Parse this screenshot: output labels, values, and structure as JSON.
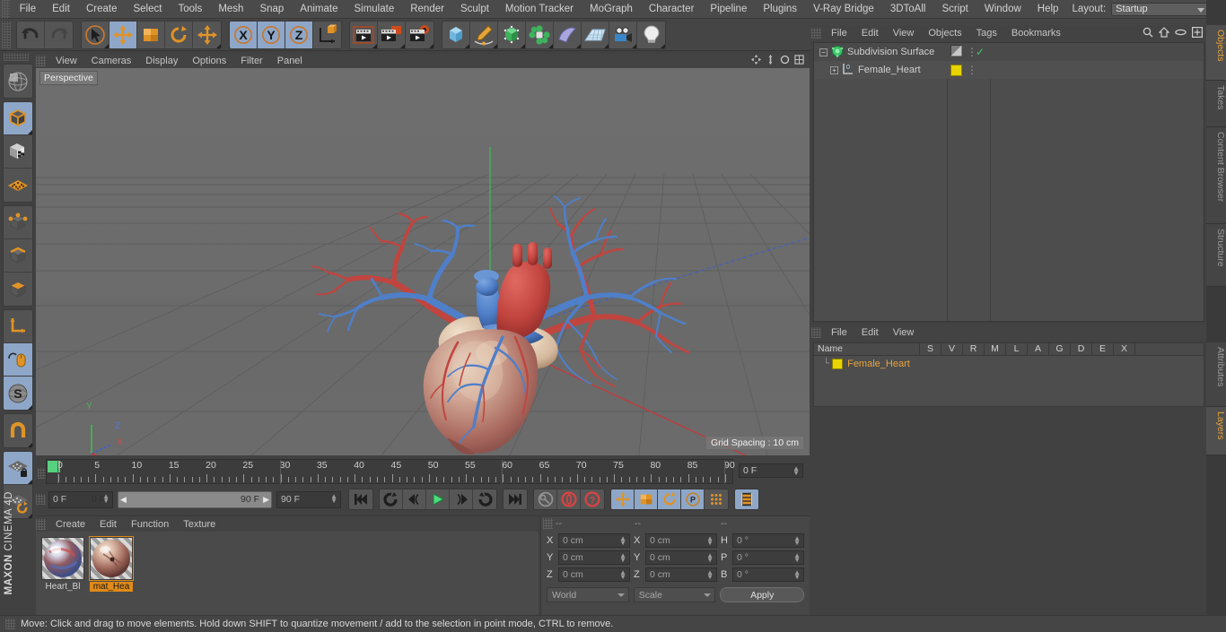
{
  "app": {
    "brand_top": "MAXON",
    "brand_bottom": "CINEMA 4D"
  },
  "menubar": {
    "items": [
      "File",
      "Edit",
      "Create",
      "Select",
      "Tools",
      "Mesh",
      "Snap",
      "Animate",
      "Simulate",
      "Render",
      "Sculpt",
      "Motion Tracker",
      "MoGraph",
      "Character",
      "Pipeline",
      "Plugins",
      "V-Ray Bridge",
      "3DToAll",
      "Script",
      "Window",
      "Help"
    ],
    "layout_label": "Layout:",
    "layout_value": "Startup",
    "search_icon": "search-icon"
  },
  "toolbar": {
    "undo": "undo-icon",
    "redo": "redo-icon",
    "select": "select-cursor-icon",
    "move": "move-axis-icon",
    "scale": "scale-icon",
    "rotate": "rotate-icon",
    "move_global": "move-global-icon",
    "axis_x": "X",
    "axis_y": "Y",
    "axis_z": "Z",
    "world_coord": "world-coordinate-icon",
    "render_view": "render-view-icon",
    "render_region": "render-region-icon",
    "render_settings": "render-settings-icon",
    "cube": "cube-primitive-icon",
    "spline": "spline-pen-icon",
    "generator": "generator-icon",
    "deformer": "deformer-icon",
    "environment": "environment-icon",
    "floor": "floor-icon",
    "camera": "camera-icon",
    "light": "light-icon"
  },
  "lefttools": {
    "items": [
      {
        "name": "make-editable-icon",
        "active": false
      },
      {
        "name": "model-mode-icon",
        "active": true
      },
      {
        "name": "texture-mode-icon",
        "active": false
      },
      {
        "name": "workplane-icon",
        "active": false
      },
      {
        "name": "points-mode-icon",
        "active": false
      },
      {
        "name": "edges-mode-icon",
        "active": false
      },
      {
        "name": "polygons-mode-icon",
        "active": false
      },
      {
        "name": "axis-modify-icon",
        "active": false
      },
      {
        "name": "enable-mouse-icon",
        "active": true
      },
      {
        "name": "soft-selection-icon",
        "active": true
      },
      {
        "name": "snap-magnet-icon",
        "active": false
      },
      {
        "name": "workplane-lock-icon",
        "active": true
      },
      {
        "name": "workplane-rotate-icon",
        "active": false
      }
    ]
  },
  "viewport": {
    "menus": [
      "View",
      "Cameras",
      "Display",
      "Options",
      "Filter",
      "Panel"
    ],
    "label": "Perspective",
    "grid_spacing": "Grid Spacing : 10 cm",
    "axis": {
      "x": "X",
      "y": "Y",
      "z": "Z"
    },
    "nav_icons": [
      "pan-icon",
      "zoom-icon",
      "rotate-view-icon",
      "maximize-icon"
    ],
    "bg_color": "#6d6d6d",
    "grid_color": "#5a5a5a",
    "axis_colors": {
      "x": "#cf3b3b",
      "y": "#3fbf4f",
      "z": "#3f5fcf"
    },
    "model": "female-heart-3d-model"
  },
  "timeline": {
    "ticks": [
      0,
      5,
      10,
      15,
      20,
      25,
      30,
      35,
      40,
      45,
      50,
      55,
      60,
      65,
      70,
      75,
      80,
      85,
      90
    ],
    "current_frame_field": "0 F",
    "playhead_frame": 0
  },
  "playback": {
    "current_frame": "0 F",
    "range_start": "0 F",
    "range_end": "90 F",
    "max_frame": "90 F",
    "buttons": [
      {
        "name": "go-to-start-button",
        "glyph": "start"
      },
      {
        "name": "previous-key-button",
        "glyph": "prevkey"
      },
      {
        "name": "step-back-button",
        "glyph": "stepback"
      },
      {
        "name": "play-button",
        "glyph": "play"
      },
      {
        "name": "step-forward-button",
        "glyph": "stepfwd"
      },
      {
        "name": "next-key-button",
        "glyph": "nextkey"
      },
      {
        "name": "go-to-end-button",
        "glyph": "end"
      },
      {
        "name": "record-key-button",
        "glyph": "key"
      },
      {
        "name": "autokey-button",
        "glyph": "autokey"
      },
      {
        "name": "keyframe-selection-button",
        "glyph": "question"
      }
    ],
    "record_toggles": [
      {
        "name": "record-position-button",
        "active": true
      },
      {
        "name": "record-scale-button",
        "active": true
      },
      {
        "name": "record-rotation-button",
        "active": true
      },
      {
        "name": "record-parameter-button",
        "active": true
      },
      {
        "name": "record-pla-button",
        "active": false
      },
      {
        "name": "keyframe-mode-button",
        "active": true
      }
    ]
  },
  "material_manager": {
    "menus": [
      "Create",
      "Edit",
      "Function",
      "Texture"
    ],
    "materials": [
      {
        "name": "Heart_Bl",
        "selected": false
      },
      {
        "name": "mat_Hea",
        "selected": true
      }
    ]
  },
  "coordinates": {
    "headers": [
      "--",
      "--",
      "--"
    ],
    "position": {
      "label_x": "X",
      "label_y": "Y",
      "label_z": "Z",
      "x": "0 cm",
      "y": "0 cm",
      "z": "0 cm"
    },
    "size": {
      "label_x": "X",
      "label_y": "Y",
      "label_z": "Z",
      "x": "0 cm",
      "y": "0 cm",
      "z": "0 cm"
    },
    "rotation": {
      "label_h": "H",
      "label_p": "P",
      "label_b": "B",
      "h": "0 °",
      "p": "0 °",
      "b": "0 °"
    },
    "coord_system": "World",
    "mode": "Scale",
    "apply_label": "Apply"
  },
  "object_manager": {
    "menus": [
      "File",
      "Edit",
      "View",
      "Objects",
      "Tags",
      "Bookmarks"
    ],
    "header_icons": [
      "search-icon",
      "home-icon",
      "ellipse-icon",
      "plus-box-icon"
    ],
    "objects": [
      {
        "name": "Subdivision Surface",
        "icon": "subdivision-surface-icon",
        "level": 0,
        "expander": "-",
        "tag_check": true,
        "tag_swatch": "gradient"
      },
      {
        "name": "Female_Heart",
        "icon": "polygon-object-icon",
        "level": 1,
        "expander": "+",
        "tag_check": false,
        "tag_swatch": "#e8d400"
      }
    ]
  },
  "layer_manager": {
    "menus": [
      "File",
      "Edit",
      "View"
    ],
    "columns": [
      "Name",
      "S",
      "V",
      "R",
      "M",
      "L",
      "A",
      "G",
      "D",
      "E",
      "X"
    ],
    "rows": [
      {
        "name": "Female_Heart",
        "color": "#e8d400"
      }
    ]
  },
  "right_tabs": {
    "top": [
      {
        "label": "Objects",
        "selected": true
      },
      {
        "label": "Takes",
        "selected": false
      },
      {
        "label": "Content Browser",
        "selected": false
      },
      {
        "label": "Structure",
        "selected": false
      }
    ],
    "bottom": [
      {
        "label": "Attributes",
        "selected": false
      },
      {
        "label": "Layers",
        "selected": true
      }
    ]
  },
  "statusbar": {
    "message": "Move: Click and drag to move elements. Hold down SHIFT to quantize movement / add to the selection in point mode, CTRL to remove."
  }
}
